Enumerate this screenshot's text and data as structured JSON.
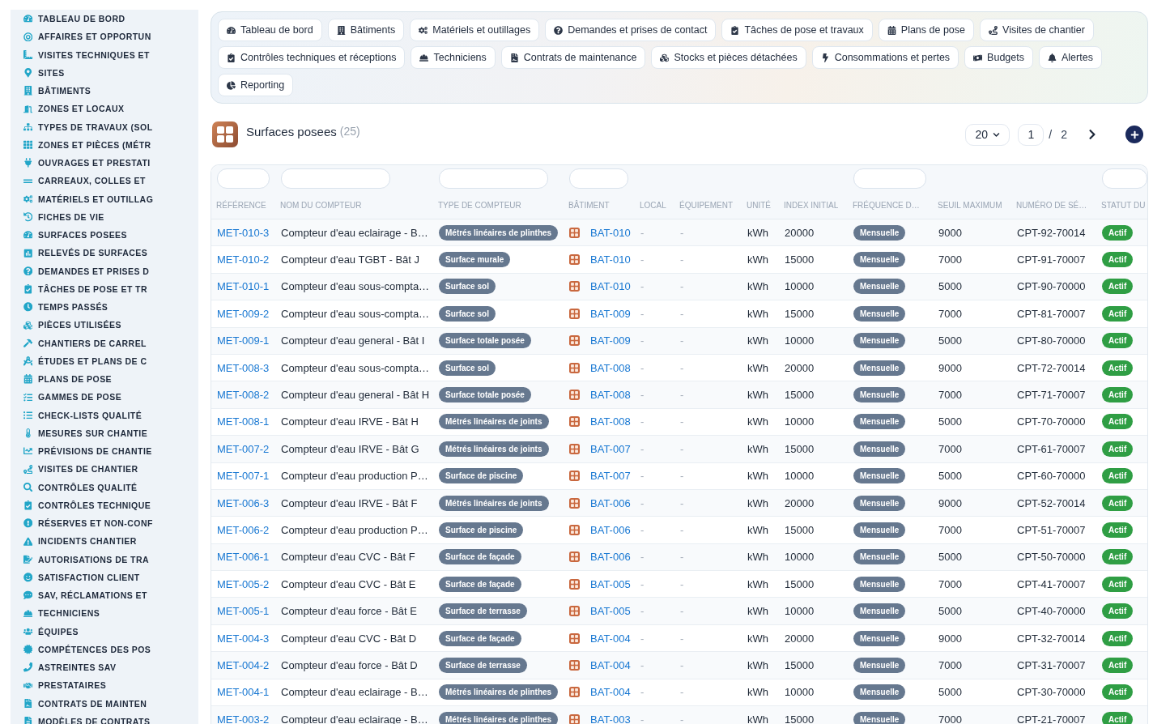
{
  "sidebar": {
    "items": [
      "TABLEAU DE BORD",
      "AFFAIRES ET OPPORTUN",
      "VISITES TECHNIQUES ET",
      "SITES",
      "BÂTIMENTS",
      "ZONES ET LOCAUX",
      "TYPES DE TRAVAUX (SOL",
      "ZONES ET PIÈCES (MÉTR",
      "OUVRAGES ET PRESTATI",
      "CARREAUX, COLLES ET",
      "MATÉRIELS ET OUTILLAG",
      "FICHES DE VIE",
      "SURFACES POSEES",
      "RELEVÉS DE SURFACES",
      "DEMANDES ET PRISES D",
      "TÂCHES DE POSE ET TR",
      "TEMPS PASSÉS",
      "PIÈCES UTILISÉES",
      "CHANTIERS DE CARREL",
      "ÉTUDES ET PLANS DE C",
      "PLANS DE POSE",
      "GAMMES DE POSE",
      "CHECK-LISTS QUALITÉ",
      "MESURES SUR CHANTIE",
      "PRÉVISIONS DE CHANTIE",
      "VISITES DE CHANTIER",
      "CONTRÔLES QUALITÉ",
      "CONTRÔLES TECHNIQUE",
      "RÉSERVES ET NON-CONF",
      "INCIDENTS CHANTIER",
      "AUTORISATIONS DE TRA",
      "SATISFACTION CLIENT",
      "SAV, RÉCLAMATIONS ET",
      "TECHNICIENS",
      "ÉQUIPES",
      "COMPÉTENCES DES POS",
      "ASTREINTES SAV",
      "PRESTATAIRES",
      "CONTRATS DE MAINTEN",
      "MODÈLES DE CONTRATS"
    ]
  },
  "nav_tabs": [
    "Tableau de bord",
    "Bâtiments",
    "Matériels et outillages",
    "Demandes et prises de contact",
    "Tâches de pose et travaux",
    "Plans de pose",
    "Visites de chantier",
    "Contrôles techniques et réceptions",
    "Techniciens",
    "Contrats de maintenance",
    "Stocks et pièces détachées",
    "Consommations et pertes",
    "Budgets",
    "Alertes",
    "Reporting"
  ],
  "header": {
    "title": "Surfaces posees",
    "count": "(25)"
  },
  "pagination": {
    "page_size": "20",
    "page": "1",
    "separator": "/",
    "total_pages": "2"
  },
  "table": {
    "columns": [
      {
        "label": "RÉFÉRENCE",
        "kind": "link",
        "filter": true
      },
      {
        "label": "NOM DU COMPTEUR",
        "kind": "text",
        "filter": true
      },
      {
        "label": "TYPE DE COMPTEUR",
        "kind": "tag",
        "filter": true
      },
      {
        "label": "BÂTIMENT",
        "kind": "building",
        "filter": true
      },
      {
        "label": "LOCAL",
        "kind": "muted",
        "filter": false
      },
      {
        "label": "ÉQUIPEMENT",
        "kind": "muted",
        "filter": false
      },
      {
        "label": "UNITÉ",
        "kind": "text",
        "filter": false
      },
      {
        "label": "INDEX INITIAL",
        "kind": "text",
        "filter": false
      },
      {
        "label": "FRÉQUENCE D…",
        "kind": "tag",
        "filter": true
      },
      {
        "label": "SEUIL MAXIMUM",
        "kind": "text",
        "filter": false
      },
      {
        "label": "NUMÉRO DE SÉ…",
        "kind": "text",
        "filter": false
      },
      {
        "label": "STATUT DU",
        "kind": "status",
        "filter": true
      }
    ],
    "rows": [
      [
        "MET-010-3",
        "Compteur d'eau eclairage - B…",
        "Métrés linéaires de plinthes",
        "BAT-010",
        "-",
        "-",
        "kWh",
        "20000",
        "Mensuelle",
        "9000",
        "CPT-92-70014",
        "Actif"
      ],
      [
        "MET-010-2",
        "Compteur d'eau TGBT - Bât J",
        "Surface murale",
        "BAT-010",
        "-",
        "-",
        "kWh",
        "15000",
        "Mensuelle",
        "7000",
        "CPT-91-70007",
        "Actif"
      ],
      [
        "MET-010-1",
        "Compteur d'eau sous-compta…",
        "Surface sol",
        "BAT-010",
        "-",
        "-",
        "kWh",
        "10000",
        "Mensuelle",
        "5000",
        "CPT-90-70000",
        "Actif"
      ],
      [
        "MET-009-2",
        "Compteur d'eau sous-compta…",
        "Surface sol",
        "BAT-009",
        "-",
        "-",
        "kWh",
        "15000",
        "Mensuelle",
        "7000",
        "CPT-81-70007",
        "Actif"
      ],
      [
        "MET-009-1",
        "Compteur d'eau general - Bât I",
        "Surface totale posée",
        "BAT-009",
        "-",
        "-",
        "kWh",
        "10000",
        "Mensuelle",
        "5000",
        "CPT-80-70000",
        "Actif"
      ],
      [
        "MET-008-3",
        "Compteur d'eau sous-compta…",
        "Surface sol",
        "BAT-008",
        "-",
        "-",
        "kWh",
        "20000",
        "Mensuelle",
        "9000",
        "CPT-72-70014",
        "Actif"
      ],
      [
        "MET-008-2",
        "Compteur d'eau general - Bât H",
        "Surface totale posée",
        "BAT-008",
        "-",
        "-",
        "kWh",
        "15000",
        "Mensuelle",
        "7000",
        "CPT-71-70007",
        "Actif"
      ],
      [
        "MET-008-1",
        "Compteur d'eau IRVE - Bât H",
        "Métrés linéaires de joints",
        "BAT-008",
        "-",
        "-",
        "kWh",
        "10000",
        "Mensuelle",
        "5000",
        "CPT-70-70000",
        "Actif"
      ],
      [
        "MET-007-2",
        "Compteur d'eau IRVE - Bât G",
        "Métrés linéaires de joints",
        "BAT-007",
        "-",
        "-",
        "kWh",
        "15000",
        "Mensuelle",
        "7000",
        "CPT-61-70007",
        "Actif"
      ],
      [
        "MET-007-1",
        "Compteur d'eau production P…",
        "Surface de piscine",
        "BAT-007",
        "-",
        "-",
        "kWh",
        "10000",
        "Mensuelle",
        "5000",
        "CPT-60-70000",
        "Actif"
      ],
      [
        "MET-006-3",
        "Compteur d'eau IRVE - Bât F",
        "Métrés linéaires de joints",
        "BAT-006",
        "-",
        "-",
        "kWh",
        "20000",
        "Mensuelle",
        "9000",
        "CPT-52-70014",
        "Actif"
      ],
      [
        "MET-006-2",
        "Compteur d'eau production P…",
        "Surface de piscine",
        "BAT-006",
        "-",
        "-",
        "kWh",
        "15000",
        "Mensuelle",
        "7000",
        "CPT-51-70007",
        "Actif"
      ],
      [
        "MET-006-1",
        "Compteur d'eau CVC - Bât F",
        "Surface de façade",
        "BAT-006",
        "-",
        "-",
        "kWh",
        "10000",
        "Mensuelle",
        "5000",
        "CPT-50-70000",
        "Actif"
      ],
      [
        "MET-005-2",
        "Compteur d'eau CVC - Bât E",
        "Surface de façade",
        "BAT-005",
        "-",
        "-",
        "kWh",
        "15000",
        "Mensuelle",
        "7000",
        "CPT-41-70007",
        "Actif"
      ],
      [
        "MET-005-1",
        "Compteur d'eau force - Bât E",
        "Surface de terrasse",
        "BAT-005",
        "-",
        "-",
        "kWh",
        "10000",
        "Mensuelle",
        "5000",
        "CPT-40-70000",
        "Actif"
      ],
      [
        "MET-004-3",
        "Compteur d'eau CVC - Bât D",
        "Surface de façade",
        "BAT-004",
        "-",
        "-",
        "kWh",
        "20000",
        "Mensuelle",
        "9000",
        "CPT-32-70014",
        "Actif"
      ],
      [
        "MET-004-2",
        "Compteur d'eau force - Bât D",
        "Surface de terrasse",
        "BAT-004",
        "-",
        "-",
        "kWh",
        "15000",
        "Mensuelle",
        "7000",
        "CPT-31-70007",
        "Actif"
      ],
      [
        "MET-004-1",
        "Compteur d'eau eclairage - B…",
        "Métrés linéaires de plinthes",
        "BAT-004",
        "-",
        "-",
        "kWh",
        "10000",
        "Mensuelle",
        "5000",
        "CPT-30-70000",
        "Actif"
      ],
      [
        "MET-003-2",
        "Compteur d'eau eclairage - B…",
        "Métrés linéaires de plinthes",
        "BAT-003",
        "-",
        "-",
        "kWh",
        "15000",
        "Mensuelle",
        "7000",
        "CPT-21-70007",
        "Actif"
      ]
    ]
  }
}
